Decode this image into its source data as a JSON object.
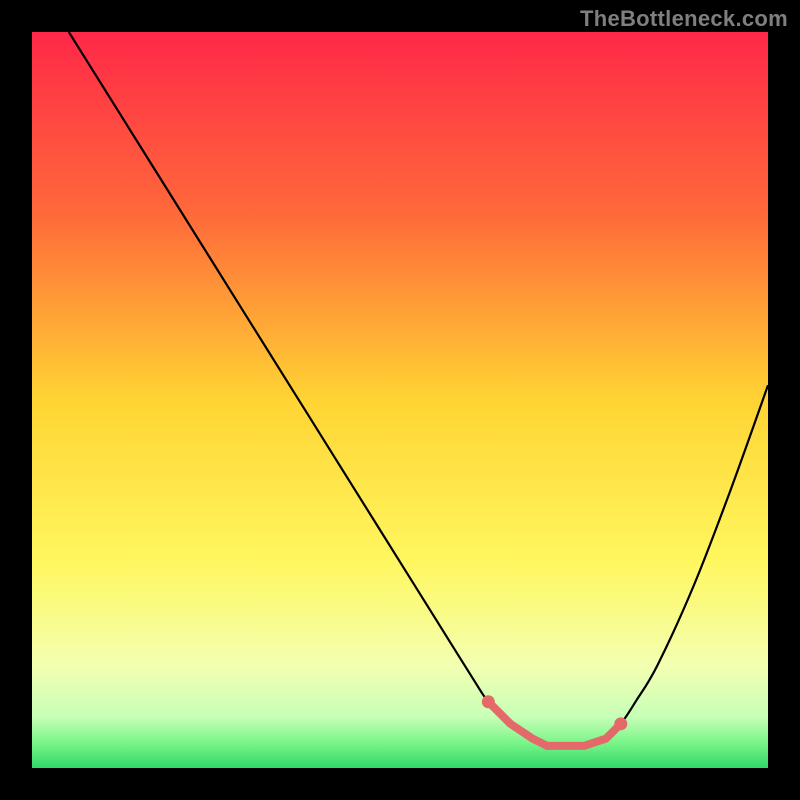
{
  "watermark": "TheBottleneck.com",
  "chart_data": {
    "type": "line",
    "title": "",
    "xlabel": "",
    "ylabel": "",
    "xlim": [
      0,
      100
    ],
    "ylim": [
      0,
      100
    ],
    "grid": false,
    "legend": false,
    "series": [
      {
        "name": "curve",
        "x": [
          5,
          10,
          15,
          20,
          25,
          30,
          35,
          40,
          45,
          50,
          55,
          60,
          62,
          65,
          68,
          70,
          72,
          75,
          78,
          80,
          82,
          85,
          90,
          95,
          100
        ],
        "y": [
          100,
          92,
          84,
          76,
          68,
          60,
          52,
          44,
          36,
          28,
          20,
          12,
          9,
          6,
          4,
          3,
          3,
          3,
          4,
          6,
          9,
          14,
          25,
          38,
          52
        ]
      }
    ],
    "markers": {
      "name": "flat-region",
      "color": "#e46a6a",
      "x": [
        62,
        65,
        68,
        70,
        72,
        75,
        78,
        80
      ],
      "y": [
        9,
        6,
        4,
        3,
        3,
        3,
        4,
        6
      ]
    },
    "background_gradient": {
      "stops": [
        {
          "offset": 0.0,
          "color": "#ff2848"
        },
        {
          "offset": 0.25,
          "color": "#ff6a3a"
        },
        {
          "offset": 0.5,
          "color": "#ffd433"
        },
        {
          "offset": 0.72,
          "color": "#fff760"
        },
        {
          "offset": 0.86,
          "color": "#f3ffb0"
        },
        {
          "offset": 0.93,
          "color": "#c8ffb8"
        },
        {
          "offset": 0.965,
          "color": "#7cf58a"
        },
        {
          "offset": 1.0,
          "color": "#2fd86a"
        }
      ]
    }
  }
}
